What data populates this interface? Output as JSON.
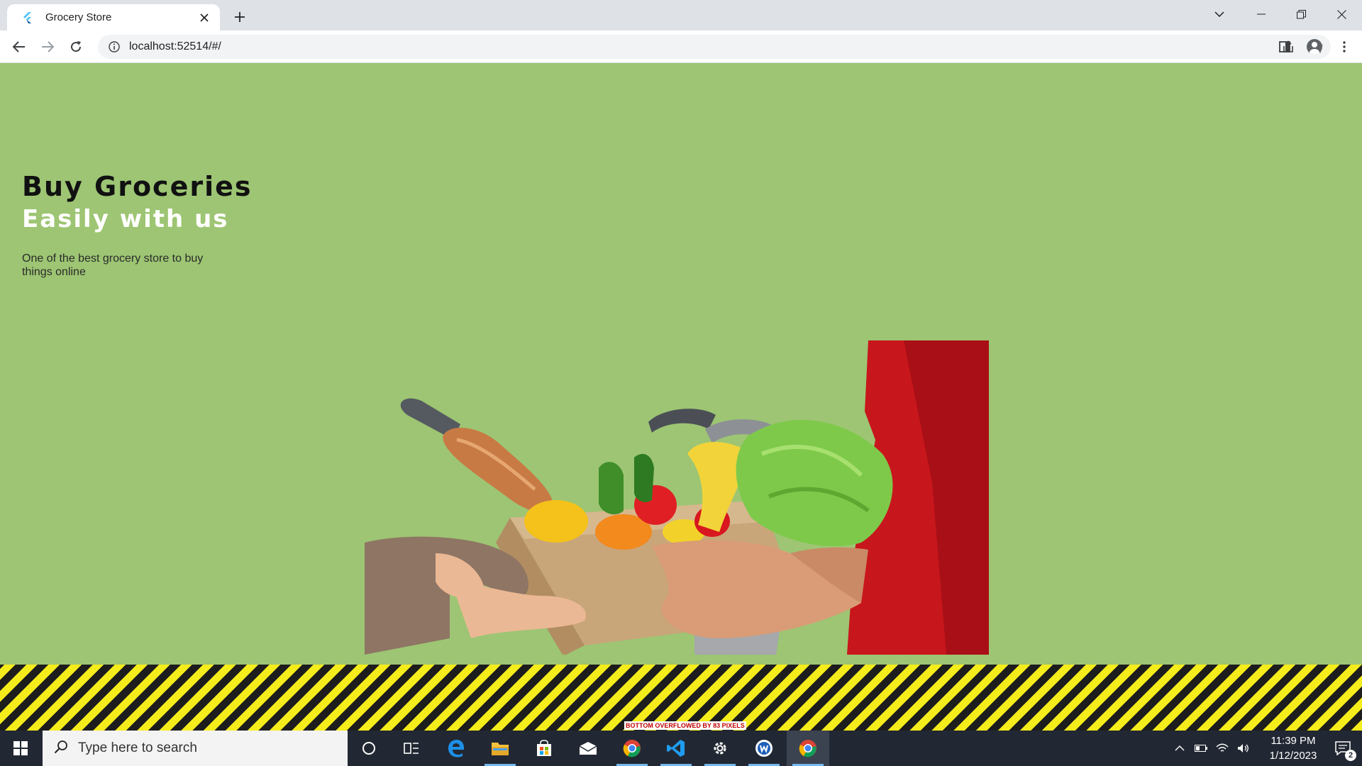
{
  "browser": {
    "tab": {
      "title": "Grocery Store",
      "favicon": "flutter-icon"
    },
    "address": {
      "url": "localhost:52514/#/"
    }
  },
  "page": {
    "title": "Buy Groceries",
    "subtitle": "Easily with us",
    "description": "One of the best grocery store to buy things online",
    "image": "grocery-box-delivery-photo",
    "overflow_message": "BOTTOM OVERFLOWED BY 83 PIXELS",
    "colors": {
      "background": "#9dc573",
      "title": "#111111",
      "subtitle": "#ffffff",
      "overflow_stripe_yellow": "#f5ec1b",
      "overflow_stripe_black": "#1d1d1d"
    }
  },
  "taskbar": {
    "search_placeholder": "Type here to search",
    "apps": [
      "cortana-icon",
      "task-view-icon",
      "edge-icon",
      "file-explorer-icon",
      "store-icon",
      "mail-icon",
      "chrome-icon",
      "vscode-icon",
      "settings-icon",
      "app-icon",
      "chrome-icon"
    ],
    "clock": {
      "time": "11:39 PM",
      "date": "1/12/2023"
    },
    "notification_count": "2"
  }
}
